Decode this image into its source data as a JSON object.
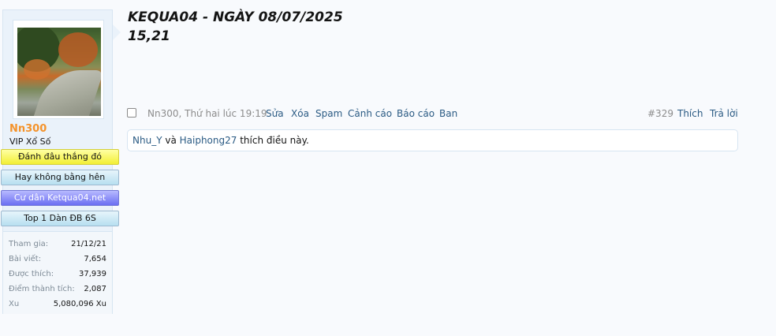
{
  "user": {
    "name": "Nn300",
    "title": "VIP Xổ Số",
    "avatar_icon": "user-avatar-garden-photo",
    "banners": [
      "Đánh đâu thắng đó",
      "Hay không bằng hên",
      "Cư dân Ketqua04.net",
      "Top 1 Dàn ĐB 6S"
    ],
    "stats": [
      {
        "label": "Tham gia:",
        "value": "21/12/21"
      },
      {
        "label": "Bài viết:",
        "value": "7,654"
      },
      {
        "label": "Được thích:",
        "value": "37,939"
      },
      {
        "label": "Điểm thành tích:",
        "value": "2,087"
      },
      {
        "label": "Xu",
        "value": "5,080,096 Xu"
      }
    ]
  },
  "post": {
    "title": "KEQUA04 - NGÀY 08/07/2025",
    "body": "15,21",
    "meta": "Nn300, Thứ hai lúc 19:19",
    "actions": {
      "edit": "Sửa",
      "delete": "Xóa",
      "spam": "Spam",
      "warn": "Cảnh cáo",
      "report": "Báo cáo",
      "ban": "Ban"
    },
    "number": "#329",
    "like": "Thích",
    "reply": "Trả lời",
    "likes": {
      "user1": "Nhu_Y",
      "conj": " và ",
      "user2": "Haiphong27",
      "suffix": " thích điều này."
    }
  },
  "colors": {
    "accent_link": "#2b5b84",
    "username": "#f4932b",
    "sidebar_bg": "#eaf2fa"
  }
}
